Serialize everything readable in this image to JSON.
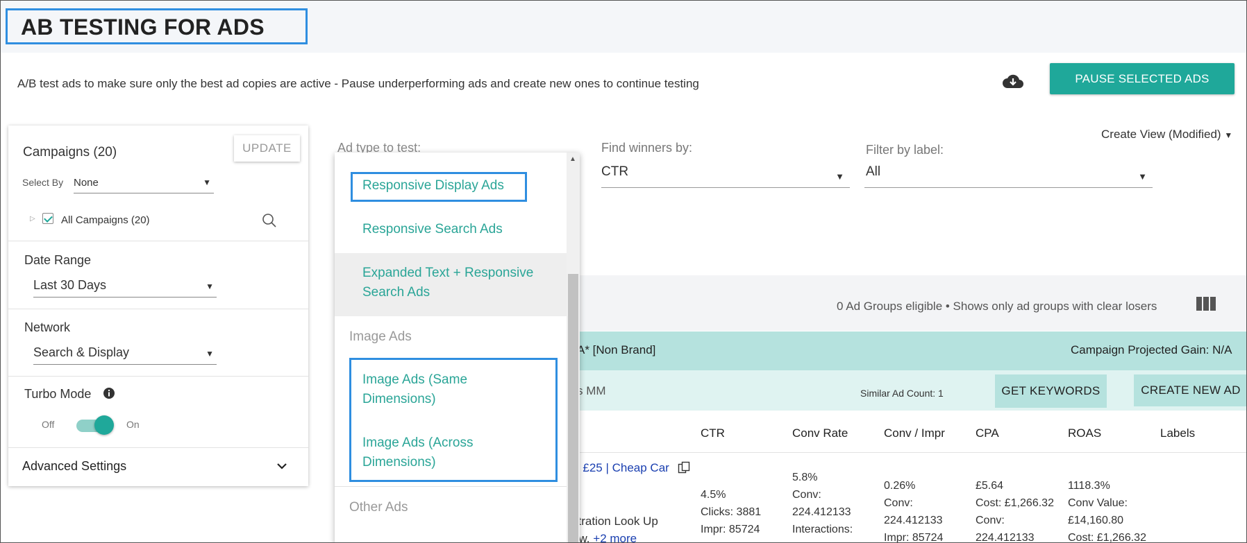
{
  "header": {
    "title": "AB TESTING FOR ADS",
    "subtitle": "A/B test ads to make sure only the best ad copies are active - Pause underperforming ads and create new ones to continue testing",
    "pause_button": "PAUSE SELECTED ADS"
  },
  "left_panel": {
    "campaigns_title": "Campaigns (20)",
    "update_button": "UPDATE",
    "select_by_label": "Select By",
    "select_by_value": "None",
    "all_campaigns": "All Campaigns (20)",
    "date_range_label": "Date Range",
    "date_range_value": "Last 30 Days",
    "network_label": "Network",
    "network_value": "Search & Display",
    "turbo_label": "Turbo Mode",
    "turbo_off": "Off",
    "turbo_on": "On",
    "advanced_settings": "Advanced Settings"
  },
  "filters": {
    "ad_type_label": "Ad type to test:",
    "find_winners_label": "Find winners by:",
    "find_winners_value": "CTR",
    "filter_label_label": "Filter by label:",
    "filter_label_value": "All",
    "create_view": "Create View (Modified)"
  },
  "dropdown": {
    "items": [
      "Responsive Display Ads",
      "Responsive Search Ads",
      "Expanded Text + Responsive Search Ads",
      "Image Ads (Same Dimensions)",
      "Image Ads (Across Dimensions)"
    ],
    "group_image": "Image Ads",
    "group_other": "Other Ads"
  },
  "content": {
    "link_fragment": "s",
    "eligible_text": "0 Ad Groups eligible • Shows only ad groups with clear losers",
    "campaign_fragment": "A* [Non Brand]",
    "projected_gain": "Campaign Projected Gain: N/A",
    "adgroup_fragment": "s MM",
    "similar_count": "Similar Ad Count: 1",
    "get_keywords": "GET KEYWORDS",
    "create_new_ad": "CREATE NEW AD",
    "columns": [
      "CTR",
      "Conv Rate",
      "Conv / Impr",
      "CPA",
      "ROAS",
      "Labels"
    ],
    "ad_link": "r £25 | Cheap Car",
    "ad_desc_1": "stration Look Up",
    "ad_desc_2": "ow.",
    "ad_more": "+2 more",
    "ctr": [
      "4.5%",
      "Clicks: 3881",
      "Impr: 85724"
    ],
    "conv_rate": [
      "5.8%",
      "Conv:",
      "224.412133",
      "Interactions:"
    ],
    "conv_impr": [
      "0.26%",
      "Conv:",
      "224.412133",
      "Impr: 85724"
    ],
    "cpa": [
      "£5.64",
      "Cost: £1,266.32",
      "Conv:",
      "224.412133"
    ],
    "roas": [
      "1118.3%",
      "Conv Value:",
      "£14,160.80",
      "Cost: £1,266.32"
    ]
  },
  "colors": {
    "accent": "#1fa89a",
    "highlight_border": "#2f8ee0",
    "teal_strip": "#b5e2de",
    "light_strip": "#dff3f1"
  }
}
